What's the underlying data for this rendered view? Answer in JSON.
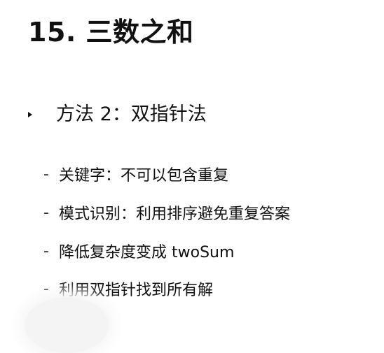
{
  "document": {
    "title": "15. 三数之和",
    "section": {
      "heading": "方法 2：双指针法",
      "items": [
        {
          "dash": "-",
          "text": "关键字：不可以包含重复"
        },
        {
          "dash": "-",
          "text": "模式识别：利用排序避免重复答案"
        },
        {
          "dash": "-",
          "text": "降低复杂度变成 twoSum"
        },
        {
          "dash": "-",
          "text": "利用双指针找到所有解"
        }
      ]
    }
  }
}
